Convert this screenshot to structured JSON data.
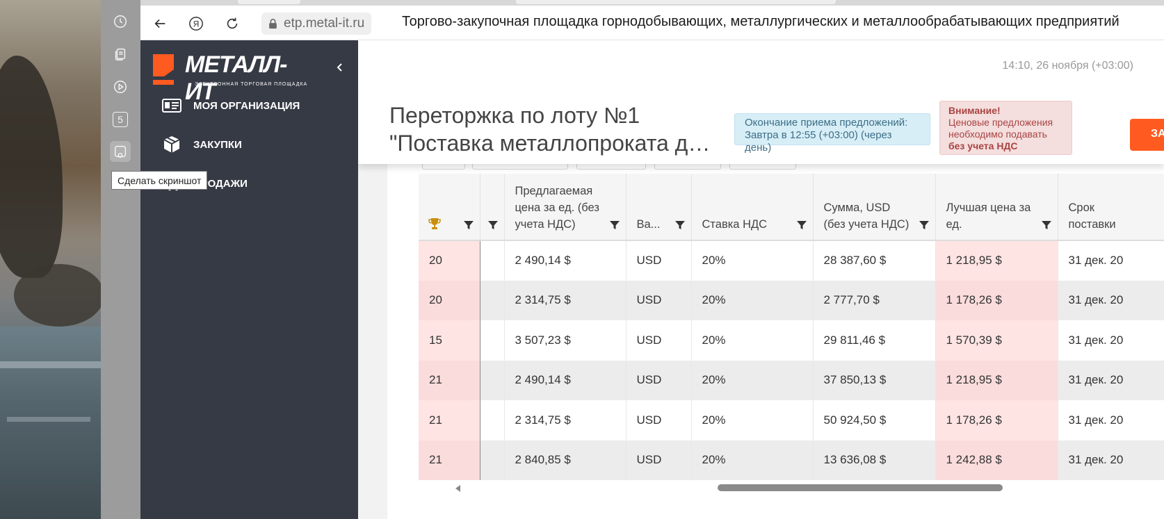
{
  "browser": {
    "url": "etp.metal-it.ru",
    "page_title": "Торгово-закупочная площадка горнодобывающих, металлургических и металлообрабатывающих предприятий",
    "side_panel_badge": "5",
    "tooltip": "Сделать скриншот"
  },
  "sidebar": {
    "logo_text": "МЕТАЛЛ-ИТ",
    "logo_subtext": "ЭЛЕКТРОННАЯ ТОРГОВАЯ ПЛОЩАДКА",
    "items": [
      {
        "label": "МОЯ ОРГАНИЗАЦИЯ",
        "icon": "id-card-icon"
      },
      {
        "label": "ЗАКУПКИ",
        "icon": "box-icon"
      },
      {
        "label": "ПРОДАЖИ",
        "icon": "cart-icon"
      }
    ]
  },
  "header": {
    "clock": "14:10, 26 ноября (+03:00)",
    "title_line1": "Переторжка по лоту №1",
    "title_line2": "\"Поставка металлопроката дл...",
    "info_line1": "Окончание приема предложений:",
    "info_line2": "Завтра в 12:55 (+03:00) (через день)",
    "warn_title": "Внимание!",
    "warn_line1": "Ценовые предложения",
    "warn_line2": "необходимо подавать",
    "warn_bold": "без учета НДС",
    "action_button": "ЗА"
  },
  "table": {
    "columns": [
      {
        "label": "",
        "icon": "trophy-icon"
      },
      {
        "label": ""
      },
      {
        "label": "Предлагаемая цена за ед. (без учета НДС)"
      },
      {
        "label": "Ва..."
      },
      {
        "label": "Ставка НДС"
      },
      {
        "label": "Сумма, USD (без учета НДС)"
      },
      {
        "label": "Лучшая цена за ед."
      },
      {
        "label": "Срок поставки"
      }
    ],
    "rows": [
      [
        "20",
        "",
        "2 490,14 $",
        "USD",
        "20%",
        "28 387,60 $",
        "1 218,95 $",
        "31 дек. 20"
      ],
      [
        "20",
        "",
        "2 314,75 $",
        "USD",
        "20%",
        "2 777,70 $",
        "1 178,26 $",
        "31 дек. 20"
      ],
      [
        "15",
        "",
        "3 507,23 $",
        "USD",
        "20%",
        "29 811,46 $",
        "1 570,39 $",
        "31 дек. 20"
      ],
      [
        "21",
        "",
        "2 490,14 $",
        "USD",
        "20%",
        "37 850,13 $",
        "1 218,95 $",
        "31 дек. 20"
      ],
      [
        "21",
        "",
        "2 314,75 $",
        "USD",
        "20%",
        "50 924,50 $",
        "1 178,26 $",
        "31 дек. 20"
      ],
      [
        "21",
        "",
        "2 840,85 $",
        "USD",
        "20%",
        "13 636,08 $",
        "1 242,88 $",
        "31 дек. 20"
      ]
    ]
  },
  "colors": {
    "accent_orange": "#ff5a1f",
    "sidebar_bg": "#363a45",
    "info_bg": "#d7eef7",
    "warn_bg": "#f4dede",
    "highlight_pink": "#ffe4e4",
    "trophy": "#c8900c"
  }
}
